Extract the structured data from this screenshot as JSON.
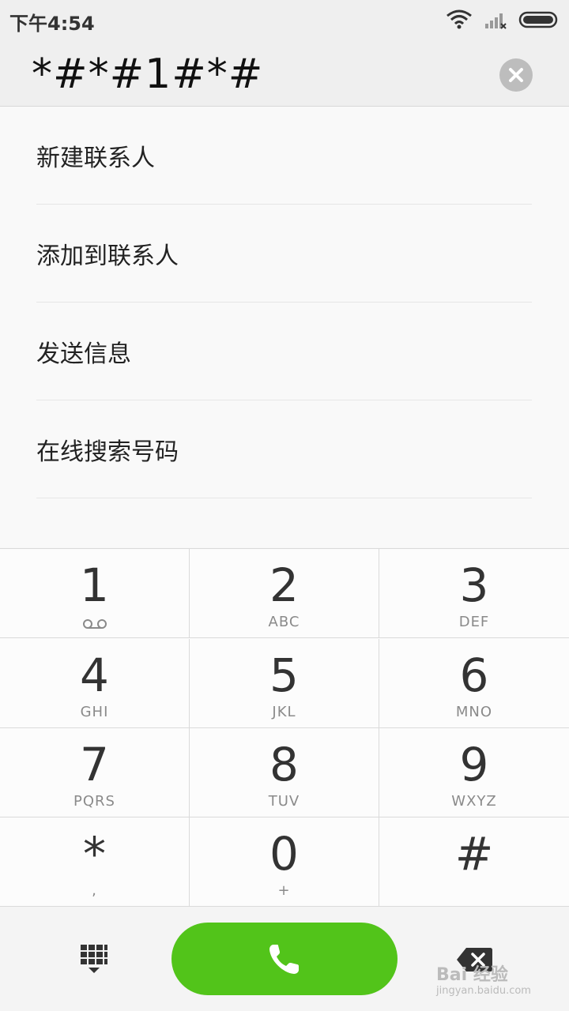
{
  "status_bar": {
    "time": "下午4:54"
  },
  "dialer": {
    "number": "*#*#1#*#"
  },
  "options": [
    {
      "label": "新建联系人"
    },
    {
      "label": "添加到联系人"
    },
    {
      "label": "发送信息"
    },
    {
      "label": "在线搜索号码"
    }
  ],
  "keypad": [
    {
      "digit": "1",
      "letters": ""
    },
    {
      "digit": "2",
      "letters": "ABC"
    },
    {
      "digit": "3",
      "letters": "DEF"
    },
    {
      "digit": "4",
      "letters": "GHI"
    },
    {
      "digit": "5",
      "letters": "JKL"
    },
    {
      "digit": "6",
      "letters": "MNO"
    },
    {
      "digit": "7",
      "letters": "PQRS"
    },
    {
      "digit": "8",
      "letters": "TUV"
    },
    {
      "digit": "9",
      "letters": "WXYZ"
    },
    {
      "digit": "*",
      "letters": ","
    },
    {
      "digit": "0",
      "letters": "+"
    },
    {
      "digit": "#",
      "letters": ""
    }
  ],
  "watermark": {
    "brand": "Bai 经验",
    "url": "jingyan.baidu.com"
  },
  "colors": {
    "call_green": "#52c41a",
    "clear_gray": "#bdbdbd"
  },
  "icons": {
    "voicemail": "voicemail-icon",
    "call": "phone-icon",
    "grid": "dialpad-grid-icon",
    "delete": "backspace-icon",
    "clear": "close-icon",
    "wifi": "wifi-icon",
    "signal": "signal-icon",
    "battery": "battery-icon"
  }
}
